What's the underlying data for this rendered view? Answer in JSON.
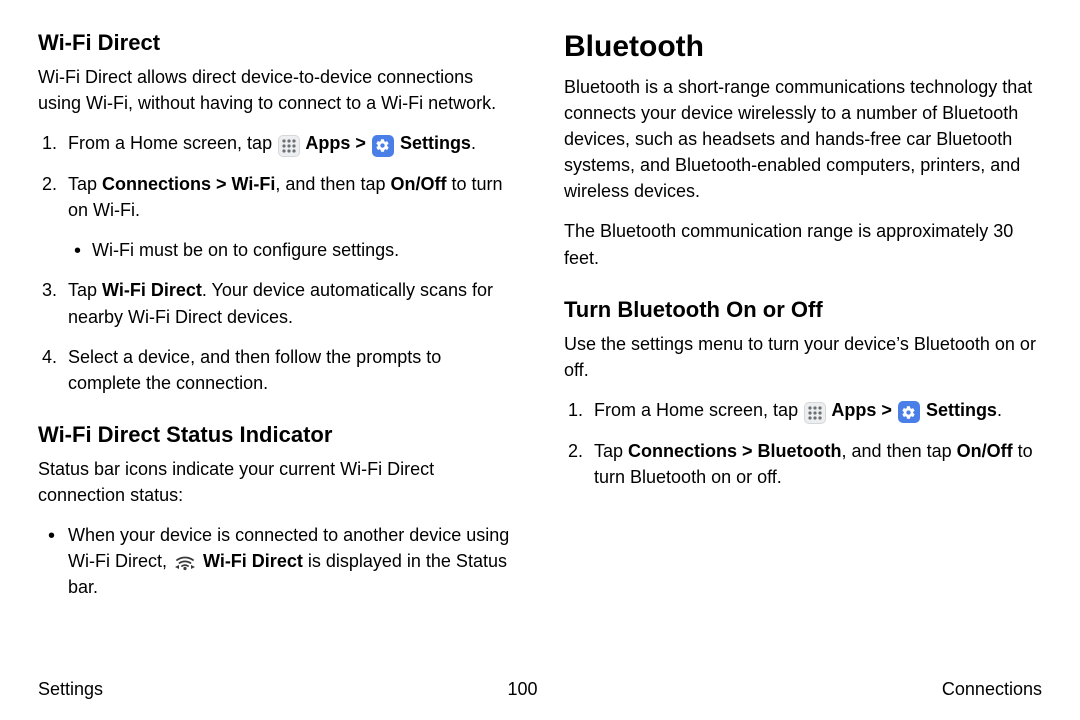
{
  "left": {
    "h_wifi_direct": "Wi‑Fi Direct",
    "wifi_direct_desc": "Wi‑Fi Direct allows direct device-to-device connections using Wi‑Fi, without having to connect to a Wi‑Fi network.",
    "step1_a": "From a Home screen, tap ",
    "apps": " Apps",
    "gt": " > ",
    "settings": " Settings",
    "period": ".",
    "step2_a": "Tap ",
    "step2_b": "Connections > Wi‑Fi",
    "step2_c": ", and then tap ",
    "step2_d": "On/Off",
    "step2_e": " to turn on Wi‑Fi.",
    "step2_sub": "Wi‑Fi must be on to configure settings.",
    "step3_a": "Tap ",
    "step3_b": "Wi‑Fi Direct",
    "step3_c": ". Your device automatically scans for nearby Wi‑Fi Direct devices.",
    "step4": "Select a device, and then follow the prompts to complete the connection.",
    "h_status": "Wi‑Fi Direct Status Indicator",
    "status_desc": "Status bar icons indicate your current Wi‑Fi Direct connection status:",
    "status_li_a": "When your device is connected to another device using Wi‑Fi Direct, ",
    "status_li_b": " Wi‑Fi Direct",
    "status_li_c": " is displayed in the Status bar."
  },
  "right": {
    "h_bt": "Bluetooth",
    "bt_desc": "Bluetooth is a short-range communications technology that connects your device wirelessly to a number of Bluetooth devices, such as headsets and hands-free car Bluetooth systems, and Bluetooth-enabled computers, printers, and wireless devices.",
    "bt_range": "The Bluetooth communication range is approximately 30 feet.",
    "h_bt_onoff": "Turn Bluetooth On or Off",
    "bt_onoff_desc": "Use the settings menu to turn your device’s Bluetooth on or off.",
    "step1_a": "From a Home screen, tap ",
    "step2_a": "Tap ",
    "step2_b": "Connections > Bluetooth",
    "step2_c": ", and then tap ",
    "step2_d": "On/Off",
    "step2_e": " to turn Bluetooth on or off."
  },
  "footer": {
    "left": "Settings",
    "center": "100",
    "right": "Connections"
  }
}
